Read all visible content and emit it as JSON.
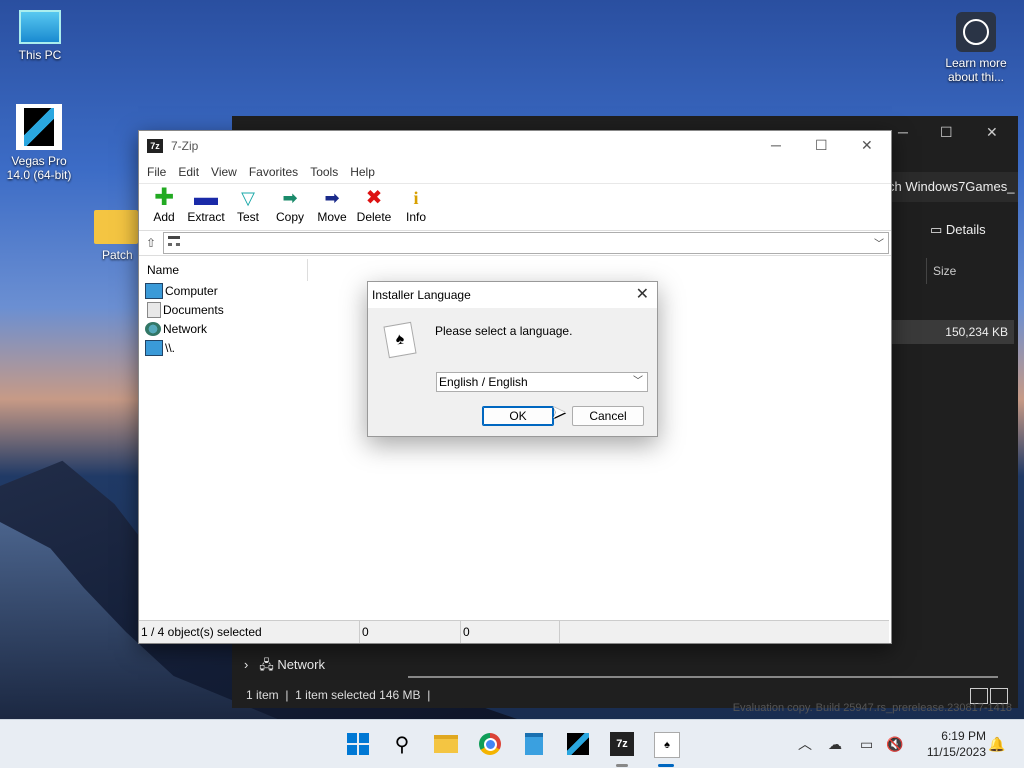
{
  "desktop": {
    "icons": [
      {
        "label": "This PC"
      },
      {
        "label": "Vegas Pro 14.0 (64-bit)"
      },
      {
        "label": "Patch"
      },
      {
        "label": "Learn more about thi..."
      }
    ]
  },
  "explorer_bg": {
    "breadcrumb": "ch Windows7Games_",
    "details_label": "Details",
    "size_header": "Size",
    "file_size": "150,234 KB",
    "nav_network": "Network",
    "status": {
      "items": "1 item",
      "selected": "1 item selected  146 MB"
    },
    "watermark": "Evaluation copy. Build 25947.rs_prerelease.230817-1418"
  },
  "zip": {
    "title": "7-Zip",
    "app_icon_text": "7z",
    "menu": [
      "File",
      "Edit",
      "View",
      "Favorites",
      "Tools",
      "Help"
    ],
    "toolbar": [
      {
        "label": "Add",
        "icon": "plus-icon",
        "color": "#22aa22"
      },
      {
        "label": "Extract",
        "icon": "minus-icon",
        "color": "#1a2aa8"
      },
      {
        "label": "Test",
        "icon": "check-icon",
        "color": "#1aa8a8"
      },
      {
        "label": "Copy",
        "icon": "copy-arrow-icon",
        "color": "#1a8a6a"
      },
      {
        "label": "Move",
        "icon": "move-arrow-icon",
        "color": "#1a2a8a"
      },
      {
        "label": "Delete",
        "icon": "x-icon",
        "color": "#dd1111"
      },
      {
        "label": "Info",
        "icon": "info-icon",
        "color": "#d8a000"
      }
    ],
    "column_name": "Name",
    "rows": [
      {
        "label": "Computer",
        "icon": "computer-icon"
      },
      {
        "label": "Documents",
        "icon": "documents-icon"
      },
      {
        "label": "Network",
        "icon": "network-icon"
      },
      {
        "label": "\\\\.",
        "icon": "drive-icon"
      }
    ],
    "status": {
      "selected": "1 / 4 object(s) selected",
      "size": "0",
      "packed": "0"
    }
  },
  "dialog": {
    "title": "Installer Language",
    "message": "Please select a language.",
    "selected_language": "English / English",
    "ok_label": "OK",
    "cancel_label": "Cancel"
  },
  "taskbar": {
    "time": "6:19 PM",
    "date": "11/15/2023"
  },
  "colors": {
    "accent": "#0067c0",
    "taskbar": "#e8edf3"
  }
}
